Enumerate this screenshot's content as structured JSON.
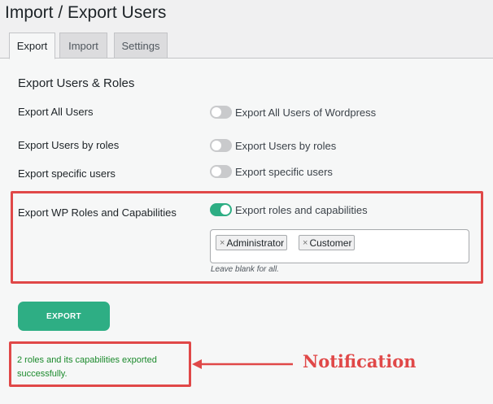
{
  "page": {
    "title": "Import / Export Users"
  },
  "tabs": [
    {
      "label": "Export",
      "active": true
    },
    {
      "label": "Import",
      "active": false
    },
    {
      "label": "Settings",
      "active": false
    }
  ],
  "export": {
    "section_title": "Export Users & Roles",
    "rows": [
      {
        "label": "Export All Users",
        "toggle_label": "Export All Users of Wordpress",
        "on": false
      },
      {
        "label": "Export Users by roles",
        "toggle_label": "Export Users by roles",
        "on": false
      },
      {
        "label": "Export specific users",
        "toggle_label": "Export specific users",
        "on": false
      },
      {
        "label": "Export WP Roles and Capabilities",
        "toggle_label": "Export roles and capabilities",
        "on": true
      }
    ],
    "selected_roles": [
      {
        "label": "Administrator",
        "remove_glyph": "×"
      },
      {
        "label": "Customer",
        "remove_glyph": "×"
      }
    ],
    "hint": "Leave blank for all.",
    "button_label": "EXPORT"
  },
  "notification": {
    "message": "2 roles and its capabilities exported successfully.",
    "annotation": "Notification"
  },
  "colors": {
    "accent": "#2eae84",
    "annotation_red": "#e04848",
    "success_text": "#1b8a2c",
    "toggle_off": "#c9cacc"
  }
}
